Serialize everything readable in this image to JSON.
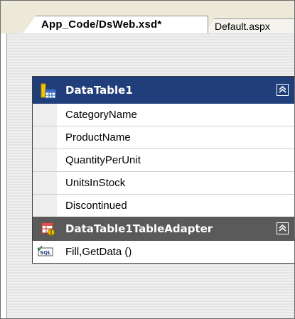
{
  "tabs": [
    {
      "label": "App_Code/DsWeb.xsd*",
      "active": true
    },
    {
      "label": "Default.aspx",
      "active": false
    }
  ],
  "datatable": {
    "title": "DataTable1",
    "icon": "datatable-icon",
    "collapse_icon": "collapse-chevron-up-icon",
    "header_color": "#1f3e7a",
    "columns": [
      "CategoryName",
      "ProductName",
      "QuantityPerUnit",
      "UnitsInStock",
      "Discontinued"
    ]
  },
  "adapter": {
    "title": "DataTable1TableAdapter",
    "icon": "tableadapter-icon",
    "collapse_icon": "collapse-chevron-up-icon",
    "header_color": "#5a5a5a",
    "query_icon": "sql-query-icon",
    "query": "Fill,GetData ()"
  }
}
